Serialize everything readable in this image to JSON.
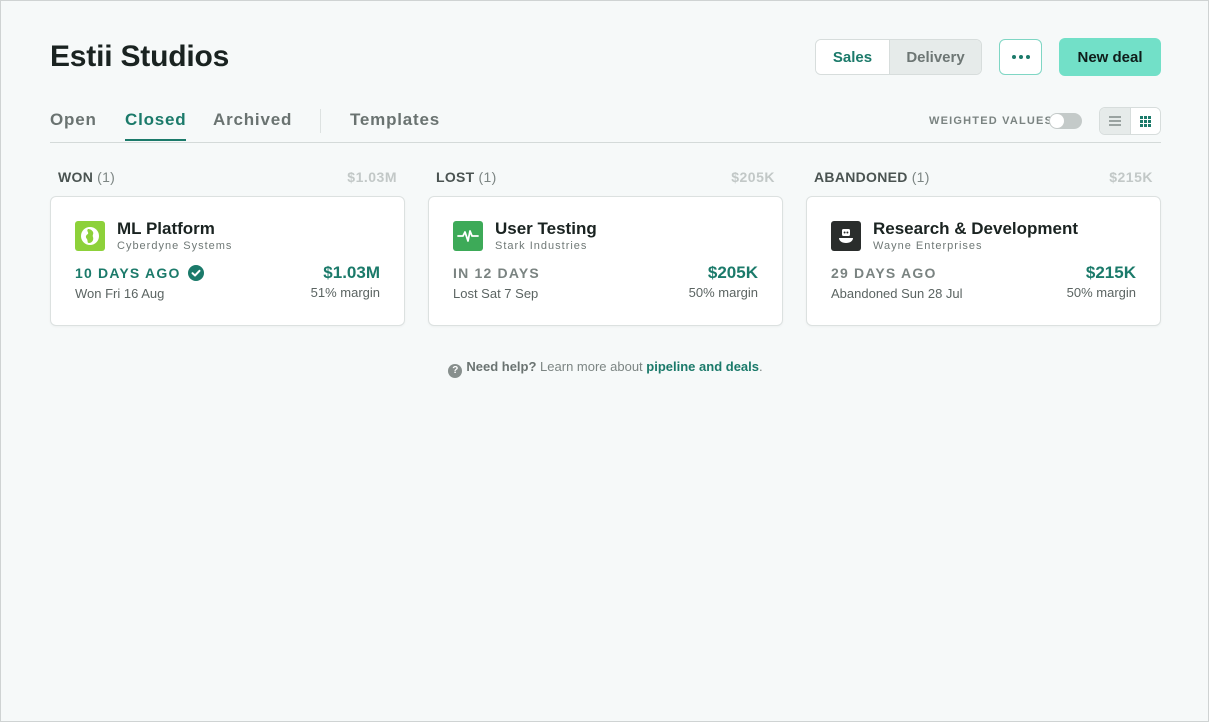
{
  "header": {
    "title": "Estii Studios",
    "segment": {
      "options": [
        "Sales",
        "Delivery"
      ],
      "selected": "Sales"
    },
    "more_icon": "ellipsis-icon",
    "new_deal_label": "New deal"
  },
  "tabs": {
    "items": [
      {
        "label": "Open",
        "active": false
      },
      {
        "label": "Closed",
        "active": true
      },
      {
        "label": "Archived",
        "active": false
      },
      {
        "label": "Templates",
        "active": false
      }
    ],
    "weighted_values_label": "WEIGHTED VALUES",
    "weighted_values_on": false,
    "view_modes": [
      "list-view-icon",
      "grid-view-icon"
    ],
    "selected_view": "grid"
  },
  "columns": [
    {
      "name": "WON",
      "count": "(1)",
      "total": "$1.03M",
      "deal": {
        "name": "ML Platform",
        "client": "Cyberdyne Systems",
        "logo_color": "#8dd13a",
        "logo_icon": "globe-icon",
        "when": "10 DAYS AGO",
        "when_verified": true,
        "date": "Won Fri 16 Aug",
        "amount": "$1.03M",
        "margin": "51% margin"
      }
    },
    {
      "name": "LOST",
      "count": "(1)",
      "total": "$205K",
      "deal": {
        "name": "User Testing",
        "client": "Stark Industries",
        "logo_color": "#3daa58",
        "logo_icon": "pulse-icon",
        "when": "IN 12 DAYS",
        "when_verified": false,
        "date": "Lost Sat 7 Sep",
        "amount": "$205K",
        "margin": "50% margin"
      }
    },
    {
      "name": "ABANDONED",
      "count": "(1)",
      "total": "$215K",
      "deal": {
        "name": "Research & Development",
        "client": "Wayne Enterprises",
        "logo_color": "#2a2d2c",
        "logo_icon": "robot-icon",
        "when": "29 DAYS AGO",
        "when_verified": false,
        "date": "Abandoned Sun 28 Jul",
        "amount": "$215K",
        "margin": "50% margin"
      }
    }
  ],
  "help": {
    "lead": "Need help?",
    "text": " Learn more about ",
    "link": "pipeline and deals",
    "trailing": "."
  },
  "colors": {
    "accent": "#1b7a6a",
    "primary_button": "#72e0c8",
    "background": "#f6f9f9"
  }
}
